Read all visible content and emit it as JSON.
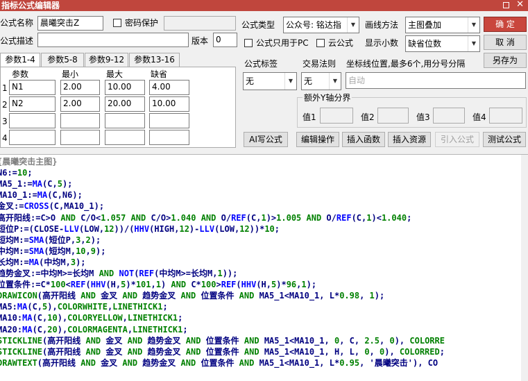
{
  "window": {
    "title": "指标公式编辑器",
    "restore_icon": "restore-icon",
    "close_icon": "close-icon",
    "close_glyph": "✕"
  },
  "formula": {
    "name_label": "公式名称",
    "name_value": "晨曦突击Z",
    "password_label": "密码保护",
    "desc_label": "公式描述",
    "desc_value": "",
    "version_label": "版本",
    "version_value": "0"
  },
  "type": {
    "type_label": "公式类型",
    "type_value": "公众号: 铭达指",
    "draw_label": "画线方法",
    "draw_value": "主图叠加",
    "pc_only_label": "公式只用于PC",
    "cloud_label": "云公式",
    "decimal_label": "显示小数",
    "decimal_value": "缺省位数"
  },
  "buttons": {
    "ok": "确  定",
    "cancel": "取  消",
    "save_as": "另存为",
    "ai_write": "AI写公式",
    "edit_ops": "编辑操作",
    "insert_func": "插入函数",
    "insert_res": "插入资源",
    "import_formula": "引入公式",
    "test_formula": "测试公式"
  },
  "params": {
    "tabs": [
      "参数1-4",
      "参数5-8",
      "参数9-12",
      "参数13-16"
    ],
    "headers": [
      "参数",
      "最小",
      "最大",
      "缺省"
    ],
    "rows": [
      {
        "index": "1",
        "name": "N1",
        "min": "2.00",
        "max": "10.00",
        "default": "4.00"
      },
      {
        "index": "2",
        "name": "N2",
        "min": "2.00",
        "max": "20.00",
        "default": "10.00"
      },
      {
        "index": "3",
        "name": "",
        "min": "",
        "max": "",
        "default": ""
      },
      {
        "index": "4",
        "name": "",
        "min": "",
        "max": "",
        "default": ""
      }
    ]
  },
  "options": {
    "tag_label": "公式标签",
    "tag_value": "无",
    "trade_label": "交易法则",
    "trade_value": "无",
    "axis_label": "坐标线位置,最多6个,用分号分隔",
    "axis_placeholder": "自动",
    "yaxis_group": "额外Y轴分界",
    "value_labels": [
      "值1",
      "值2",
      "值3",
      "值4"
    ]
  },
  "code": {
    "lines": [
      [
        [
          "{晨曦突击主图}",
          "#808080"
        ]
      ],
      [
        [
          "N6:=",
          "#000080"
        ],
        [
          "10",
          "#008000"
        ],
        [
          ";",
          "#000080"
        ]
      ],
      [
        [
          "MA5_1:=",
          "#000080"
        ],
        [
          "MA",
          "#0000ff"
        ],
        [
          "(C,",
          "#000080"
        ],
        [
          "5",
          "#008000"
        ],
        [
          ");",
          "#000080"
        ]
      ],
      [
        [
          "MA10_1:=",
          "#000080"
        ],
        [
          "MA",
          "#0000ff"
        ],
        [
          "(C,N6);",
          "#000080"
        ]
      ],
      [
        [
          "金叉:=",
          "#000080"
        ],
        [
          "CROSS",
          "#0000ff"
        ],
        [
          "(C,MA10_1);",
          "#000080"
        ]
      ],
      [
        [
          "高开阳线:=C>O ",
          "#000080"
        ],
        [
          "AND",
          "#008000"
        ],
        [
          " C/O<",
          "#000080"
        ],
        [
          "1.057",
          "#008000"
        ],
        [
          " ",
          "#000080"
        ],
        [
          "AND",
          "#008000"
        ],
        [
          " C/O>",
          "#000080"
        ],
        [
          "1.040",
          "#008000"
        ],
        [
          " ",
          "#000080"
        ],
        [
          "AND",
          "#008000"
        ],
        [
          " O/",
          "#000080"
        ],
        [
          "REF",
          "#0000ff"
        ],
        [
          "(C,",
          "#000080"
        ],
        [
          "1",
          "#008000"
        ],
        [
          ")>",
          "#000080"
        ],
        [
          "1.005",
          "#008000"
        ],
        [
          " ",
          "#000080"
        ],
        [
          "AND",
          "#008000"
        ],
        [
          " O/",
          "#000080"
        ],
        [
          "REF",
          "#0000ff"
        ],
        [
          "(C,",
          "#000080"
        ],
        [
          "1",
          "#008000"
        ],
        [
          ")<",
          "#000080"
        ],
        [
          "1.040",
          "#008000"
        ],
        [
          ";",
          "#000080"
        ]
      ],
      [
        [
          "短位P:=(CLOSE-",
          "#000080"
        ],
        [
          "LLV",
          "#0000ff"
        ],
        [
          "(LOW,",
          "#000080"
        ],
        [
          "12",
          "#008000"
        ],
        [
          "))/(",
          "#000080"
        ],
        [
          "HHV",
          "#0000ff"
        ],
        [
          "(HIGH,",
          "#000080"
        ],
        [
          "12",
          "#008000"
        ],
        [
          ")-",
          "#000080"
        ],
        [
          "LLV",
          "#0000ff"
        ],
        [
          "(LOW,",
          "#000080"
        ],
        [
          "12",
          "#008000"
        ],
        [
          "))*",
          "#000080"
        ],
        [
          "10",
          "#008000"
        ],
        [
          ";",
          "#000080"
        ]
      ],
      [
        [
          "短均M:=",
          "#000080"
        ],
        [
          "SMA",
          "#0000ff"
        ],
        [
          "(短位P,",
          "#000080"
        ],
        [
          "3",
          "#008000"
        ],
        [
          ",",
          "#000080"
        ],
        [
          "2",
          "#008000"
        ],
        [
          ");",
          "#000080"
        ]
      ],
      [
        [
          "中均M:=",
          "#000080"
        ],
        [
          "SMA",
          "#0000ff"
        ],
        [
          "(短均M,",
          "#000080"
        ],
        [
          "10",
          "#008000"
        ],
        [
          ",",
          "#000080"
        ],
        [
          "9",
          "#008000"
        ],
        [
          ");",
          "#000080"
        ]
      ],
      [
        [
          "长均M:=",
          "#000080"
        ],
        [
          "MA",
          "#0000ff"
        ],
        [
          "(中均M,",
          "#000080"
        ],
        [
          "3",
          "#008000"
        ],
        [
          ");",
          "#000080"
        ]
      ],
      [
        [
          "趋势金叉:=中均M>=长均M ",
          "#000080"
        ],
        [
          "AND",
          "#008000"
        ],
        [
          " ",
          "#000080"
        ],
        [
          "NOT",
          "#0000ff"
        ],
        [
          "(",
          "#000080"
        ],
        [
          "REF",
          "#0000ff"
        ],
        [
          "(中均M>=长均M,",
          "#000080"
        ],
        [
          "1",
          "#008000"
        ],
        [
          "));",
          "#000080"
        ]
      ],
      [
        [
          "位置条件:=C*",
          "#000080"
        ],
        [
          "100",
          "#008000"
        ],
        [
          "<",
          "#000080"
        ],
        [
          "REF",
          "#0000ff"
        ],
        [
          "(",
          "#000080"
        ],
        [
          "HHV",
          "#0000ff"
        ],
        [
          "(H,",
          "#000080"
        ],
        [
          "5",
          "#008000"
        ],
        [
          ")*",
          "#000080"
        ],
        [
          "101",
          "#008000"
        ],
        [
          ",",
          "#000080"
        ],
        [
          "1",
          "#008000"
        ],
        [
          ") ",
          "#000080"
        ],
        [
          "AND",
          "#008000"
        ],
        [
          " C*",
          "#000080"
        ],
        [
          "100",
          "#008000"
        ],
        [
          ">",
          "#000080"
        ],
        [
          "REF",
          "#0000ff"
        ],
        [
          "(",
          "#000080"
        ],
        [
          "HHV",
          "#0000ff"
        ],
        [
          "(H,",
          "#000080"
        ],
        [
          "5",
          "#008000"
        ],
        [
          ")*",
          "#000080"
        ],
        [
          "96",
          "#008000"
        ],
        [
          ",",
          "#000080"
        ],
        [
          "1",
          "#008000"
        ],
        [
          ");",
          "#000080"
        ]
      ],
      [
        [
          "DRAWICON",
          "#008000"
        ],
        [
          "(高开阳线 ",
          "#000080"
        ],
        [
          "AND",
          "#008000"
        ],
        [
          " 金叉 ",
          "#000080"
        ],
        [
          "AND",
          "#008000"
        ],
        [
          " 趋势金叉 ",
          "#000080"
        ],
        [
          "AND",
          "#008000"
        ],
        [
          " 位置条件 ",
          "#000080"
        ],
        [
          "AND",
          "#008000"
        ],
        [
          " MA5_1<MA10_1, L*",
          "#000080"
        ],
        [
          "0.98",
          "#008000"
        ],
        [
          ", ",
          "#000080"
        ],
        [
          "1",
          "#008000"
        ],
        [
          ");",
          "#000080"
        ]
      ],
      [
        [
          "MA5:",
          "#000080"
        ],
        [
          "MA",
          "#0000ff"
        ],
        [
          "(C,",
          "#000080"
        ],
        [
          "5",
          "#008000"
        ],
        [
          "),",
          "#000080"
        ],
        [
          "COLORWHITE",
          "#008000"
        ],
        [
          ",",
          "#000080"
        ],
        [
          "LINETHICK1",
          "#008000"
        ],
        [
          ";",
          "#000080"
        ]
      ],
      [
        [
          "MA10:",
          "#000080"
        ],
        [
          "MA",
          "#0000ff"
        ],
        [
          "(C,",
          "#000080"
        ],
        [
          "10",
          "#008000"
        ],
        [
          "),",
          "#000080"
        ],
        [
          "COLORYELLOW",
          "#008000"
        ],
        [
          ",",
          "#000080"
        ],
        [
          "LINETHICK1",
          "#008000"
        ],
        [
          ";",
          "#000080"
        ]
      ],
      [
        [
          "MA20:",
          "#000080"
        ],
        [
          "MA",
          "#0000ff"
        ],
        [
          "(C,",
          "#000080"
        ],
        [
          "20",
          "#008000"
        ],
        [
          "),",
          "#000080"
        ],
        [
          "COLORMAGENTA",
          "#008000"
        ],
        [
          ",",
          "#000080"
        ],
        [
          "LINETHICK1",
          "#008000"
        ],
        [
          ";",
          "#000080"
        ]
      ],
      [
        [
          "STICKLINE",
          "#008000"
        ],
        [
          "(高开阳线 ",
          "#000080"
        ],
        [
          "AND",
          "#008000"
        ],
        [
          " 金叉 ",
          "#000080"
        ],
        [
          "AND",
          "#008000"
        ],
        [
          " 趋势金叉 ",
          "#000080"
        ],
        [
          "AND",
          "#008000"
        ],
        [
          " 位置条件 ",
          "#000080"
        ],
        [
          "AND",
          "#008000"
        ],
        [
          " MA5_1<MA10_1, ",
          "#000080"
        ],
        [
          "0",
          "#008000"
        ],
        [
          ", C, ",
          "#000080"
        ],
        [
          "2.5",
          "#008000"
        ],
        [
          ", ",
          "#000080"
        ],
        [
          "0",
          "#008000"
        ],
        [
          "), ",
          "#000080"
        ],
        [
          "COLORRE",
          "#008000"
        ]
      ],
      [
        [
          "STICKLINE",
          "#008000"
        ],
        [
          "(高开阳线 ",
          "#000080"
        ],
        [
          "AND",
          "#008000"
        ],
        [
          " 金叉 ",
          "#000080"
        ],
        [
          "AND",
          "#008000"
        ],
        [
          " 趋势金叉 ",
          "#000080"
        ],
        [
          "AND",
          "#008000"
        ],
        [
          " 位置条件 ",
          "#000080"
        ],
        [
          "AND",
          "#008000"
        ],
        [
          " MA5_1<MA10_1, H, L, ",
          "#000080"
        ],
        [
          "0",
          "#008000"
        ],
        [
          ", ",
          "#000080"
        ],
        [
          "0",
          "#008000"
        ],
        [
          "), ",
          "#000080"
        ],
        [
          "COLORRED",
          "#008000"
        ],
        [
          ";",
          "#000080"
        ]
      ],
      [
        [
          "DRAWTEXT",
          "#008000"
        ],
        [
          "(高开阳线 ",
          "#000080"
        ],
        [
          "AND",
          "#008000"
        ],
        [
          " 金叉 ",
          "#000080"
        ],
        [
          "AND",
          "#008000"
        ],
        [
          " 趋势金叉 ",
          "#000080"
        ],
        [
          "AND",
          "#008000"
        ],
        [
          " 位置条件 ",
          "#000080"
        ],
        [
          "AND",
          "#008000"
        ],
        [
          " MA5_1<MA10_1, L*",
          "#000080"
        ],
        [
          "0.95",
          "#008000"
        ],
        [
          ", '晨曦突击'), CO",
          "#000080"
        ]
      ]
    ]
  }
}
